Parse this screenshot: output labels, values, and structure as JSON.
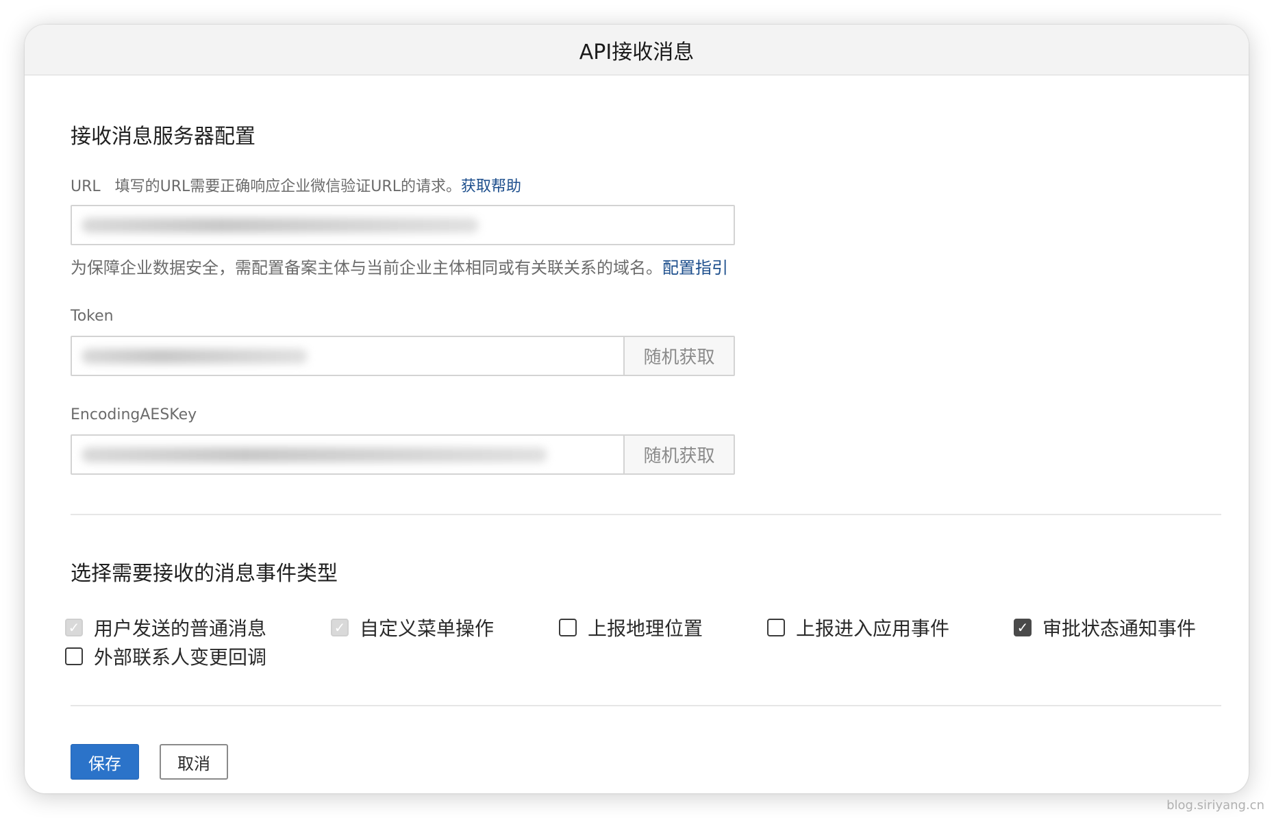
{
  "dialog": {
    "title": "API接收消息"
  },
  "server_config": {
    "heading": "接收消息服务器配置",
    "url": {
      "label": "URL",
      "hint": "填写的URL需要正确响应企业微信验证URL的请求。",
      "help_link": "获取帮助",
      "value": ""
    },
    "domain_note": "为保障企业数据安全，需配置备案主体与当前企业主体相同或有关联关系的域名。",
    "domain_link": "配置指引",
    "token": {
      "label": "Token",
      "value": "",
      "button": "随机获取"
    },
    "aes_key": {
      "label": "EncodingAESKey",
      "value": "",
      "button": "随机获取"
    }
  },
  "events": {
    "heading": "选择需要接收的消息事件类型",
    "items": [
      {
        "label": "用户发送的普通消息",
        "checked": true,
        "disabled": true
      },
      {
        "label": "自定义菜单操作",
        "checked": true,
        "disabled": true
      },
      {
        "label": "上报地理位置",
        "checked": false,
        "disabled": false
      },
      {
        "label": "上报进入应用事件",
        "checked": false,
        "disabled": false
      },
      {
        "label": "审批状态通知事件",
        "checked": true,
        "disabled": false
      },
      {
        "label": "外部联系人变更回调",
        "checked": false,
        "disabled": false
      }
    ]
  },
  "actions": {
    "save": "保存",
    "cancel": "取消"
  },
  "watermark": "blog.siriyang.cn"
}
